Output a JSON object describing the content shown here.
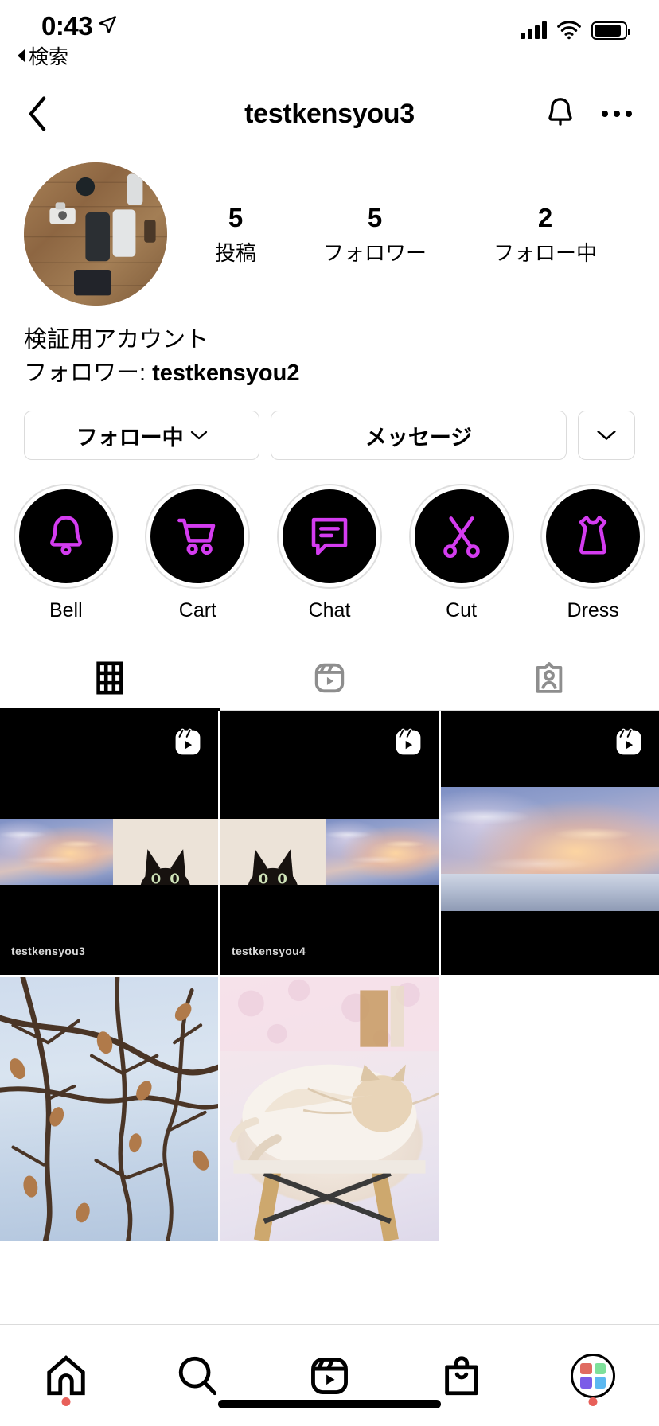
{
  "status_bar": {
    "time": "0:43",
    "back_label": "検索",
    "location_icon": "location-arrow-icon",
    "signal_icon": "cellular-signal-icon",
    "wifi_icon": "wifi-icon",
    "battery_icon": "battery-icon"
  },
  "header": {
    "back_icon": "chevron-left-icon",
    "title": "testkensyou3",
    "bell_icon": "notification-bell-icon",
    "more_icon": "more-options-icon"
  },
  "profile": {
    "avatar_alt": "profile-photo-phones-on-wood",
    "stats": [
      {
        "num": "5",
        "label": "投稿"
      },
      {
        "num": "5",
        "label": "フォロワー"
      },
      {
        "num": "2",
        "label": "フォロー中"
      }
    ],
    "bio_name": "検証用アカウント",
    "bio_followed_by_prefix": "フォロワー: ",
    "bio_followed_by_user": "testkensyou2"
  },
  "actions": {
    "follow_label": "フォロー中",
    "message_label": "メッセージ",
    "more_icon": "chevron-down-icon"
  },
  "highlights": [
    {
      "label": "Bell",
      "icon": "bell-icon"
    },
    {
      "label": "Cart",
      "icon": "shopping-cart-icon"
    },
    {
      "label": "Chat",
      "icon": "chat-bubble-icon"
    },
    {
      "label": "Cut",
      "icon": "scissors-icon"
    },
    {
      "label": "Dress",
      "icon": "dress-icon"
    }
  ],
  "tabs": [
    {
      "name": "grid",
      "icon": "grid-icon",
      "active": true
    },
    {
      "name": "reels",
      "icon": "reels-icon",
      "active": false
    },
    {
      "name": "tagged",
      "icon": "tagged-icon",
      "active": false
    }
  ],
  "posts": [
    {
      "type": "reel",
      "media": "reel-sunset-cat",
      "badge": "reels-icon",
      "watermark": "testkensyou3"
    },
    {
      "type": "reel",
      "media": "reel-cat-sunset",
      "badge": "reels-icon",
      "watermark": "testkensyou4"
    },
    {
      "type": "reel",
      "media": "reel-sunset-sea",
      "badge": "reels-icon",
      "watermark": ""
    },
    {
      "type": "photo",
      "media": "photo-winter-branches",
      "badge": "",
      "watermark": ""
    },
    {
      "type": "photo",
      "media": "photo-sleeping-cat",
      "badge": "",
      "watermark": ""
    }
  ],
  "bottom_nav": [
    {
      "name": "home",
      "icon": "home-icon",
      "badge": true
    },
    {
      "name": "search",
      "icon": "search-icon",
      "badge": false
    },
    {
      "name": "reels",
      "icon": "reels-icon",
      "badge": false
    },
    {
      "name": "shop",
      "icon": "shopping-bag-icon",
      "badge": false
    },
    {
      "name": "profile",
      "icon": "profile-avatar-icon",
      "badge": true
    }
  ],
  "colors": {
    "highlight_icon": "#d43cf0",
    "highlight_bg": "#000000",
    "badge_red": "#e8605a",
    "border": "#dbdbdb",
    "avatar_tiles": [
      "#e06b62",
      "#7ee09a",
      "#7b5ce8",
      "#5cb8f0"
    ]
  }
}
